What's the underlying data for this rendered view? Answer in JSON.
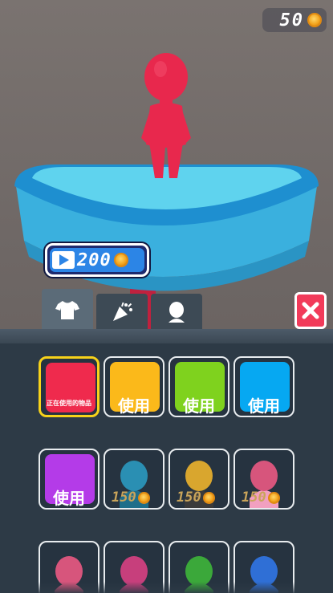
{
  "hud": {
    "coins": "50",
    "coin_icon": "coin-icon"
  },
  "stage": {
    "character_color": "#e8284d",
    "platform_color": "#3fb8e0",
    "price_tag": {
      "amount": "200",
      "icon": "video-play-icon"
    }
  },
  "tabs": [
    {
      "name": "clothing",
      "icon": "shirt-icon",
      "active": true
    },
    {
      "name": "effects",
      "icon": "party-popper-icon",
      "active": false
    },
    {
      "name": "avatar",
      "icon": "head-icon",
      "active": false
    }
  ],
  "close_icon": "close-x-icon",
  "items": [
    {
      "type": "color",
      "color": "#ef2a4d",
      "label": "正在使用的物品",
      "selected": true
    },
    {
      "type": "color",
      "color": "#fbb91a",
      "label": "使用",
      "selected": false
    },
    {
      "type": "color",
      "color": "#7fd21e",
      "label": "使用",
      "selected": false
    },
    {
      "type": "color",
      "color": "#06a8f2",
      "label": "使用",
      "selected": false
    },
    {
      "type": "color",
      "color": "#b43be8",
      "label": "使用",
      "selected": false
    },
    {
      "type": "locked",
      "color": "#2a8fb3",
      "accent": "#1f6e8a",
      "price": "150"
    },
    {
      "type": "locked",
      "color": "#d9a62e",
      "accent": "#3b3b3b",
      "price": "150"
    },
    {
      "type": "locked",
      "color": "#d7557c",
      "accent": "#f2a0c0",
      "price": "150"
    },
    {
      "type": "partial",
      "color": "#d7557c"
    },
    {
      "type": "partial",
      "color": "#c73f7c"
    },
    {
      "type": "partial",
      "color": "#3ba83a"
    },
    {
      "type": "partial",
      "color": "#2f6fd6"
    }
  ]
}
